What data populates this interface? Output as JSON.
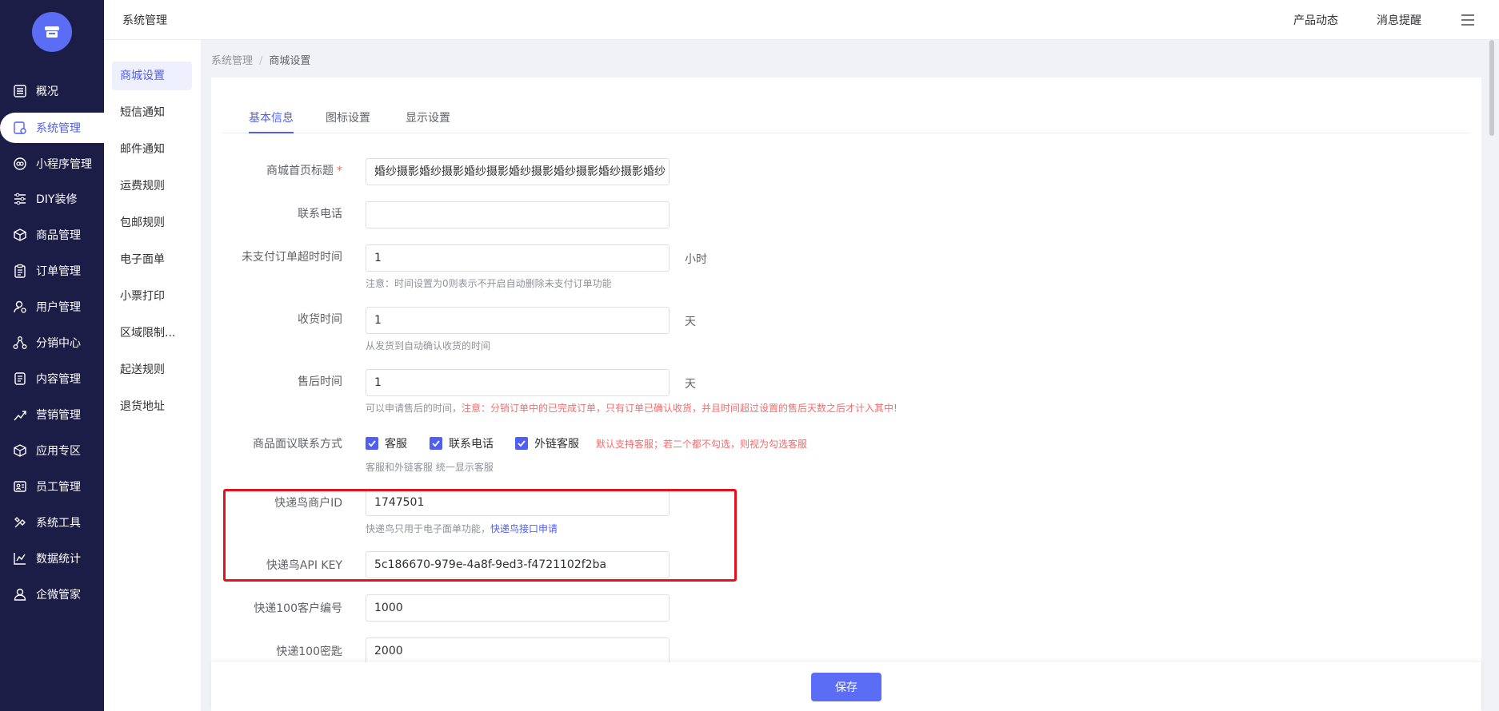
{
  "nav": {
    "items": [
      {
        "label": "概况",
        "icon": "list-icon"
      },
      {
        "label": "系统管理",
        "icon": "settings-doc-icon"
      },
      {
        "label": "小程序管理",
        "icon": "miniapp-icon"
      },
      {
        "label": "DIY装修",
        "icon": "sliders-icon"
      },
      {
        "label": "商品管理",
        "icon": "box-icon"
      },
      {
        "label": "订单管理",
        "icon": "clipboard-icon"
      },
      {
        "label": "用户管理",
        "icon": "user-gear-icon"
      },
      {
        "label": "分销中心",
        "icon": "network-icon"
      },
      {
        "label": "内容管理",
        "icon": "document-icon"
      },
      {
        "label": "营销管理",
        "icon": "chart-icon"
      },
      {
        "label": "应用专区",
        "icon": "cube-icon"
      },
      {
        "label": "员工管理",
        "icon": "id-card-icon"
      },
      {
        "label": "系统工具",
        "icon": "tools-icon"
      },
      {
        "label": "数据统计",
        "icon": "line-chart-icon"
      },
      {
        "label": "企微管家",
        "icon": "contact-icon"
      }
    ]
  },
  "submenu": {
    "items": [
      "商城设置",
      "短信通知",
      "邮件通知",
      "运费规则",
      "包邮规则",
      "电子面单",
      "小票打印",
      "区域限制...",
      "起送规则",
      "退货地址"
    ]
  },
  "header": {
    "title": "系统管理",
    "links": [
      "产品动态",
      "消息提醒"
    ]
  },
  "breadcrumb": {
    "parent": "系统管理",
    "separator": "/",
    "current": "商城设置"
  },
  "tabs": [
    "基本信息",
    "图标设置",
    "显示设置"
  ],
  "form": {
    "title_label": "商城首页标题",
    "title_value": "婚纱摄影婚纱摄影婚纱摄影婚纱摄影婚纱摄影婚纱摄影婚纱",
    "phone_label": "联系电话",
    "phone_value": "",
    "unpaid_label": "未支付订单超时时间",
    "unpaid_value": "1",
    "unpaid_unit": "小时",
    "unpaid_tip": "注意：时间设置为0则表示不开启自动删除未支付订单功能",
    "receive_label": "收货时间",
    "receive_value": "1",
    "receive_unit": "天",
    "receive_tip": "从发货到自动确认收货的时间",
    "aftersale_label": "售后时间",
    "aftersale_value": "1",
    "aftersale_unit": "天",
    "aftersale_tip": "可以申请售后的时间，",
    "aftersale_warn": "注意：分销订单中的已完成订单，只有订单已确认收货，并且时间超过设置的售后天数之后才计入其中!",
    "contact_label": "商品面议联系方式",
    "contact_options": [
      "客服",
      "联系电话",
      "外链客服"
    ],
    "contact_note": "默认支持客服；若二个都不勾选，则视为勾选客服",
    "contact_tip": "客服和外链客服 统一显示客服",
    "kdn_id_label": "快递鸟商户ID",
    "kdn_id_value": "1747501",
    "kdn_id_tip": "快递鸟只用于电子面单功能，",
    "kdn_id_link": "快递鸟接口申请",
    "kdn_key_label": "快递鸟API KEY",
    "kdn_key_value": "5c186670-979e-4a8f-9ed3-f4721102f2ba",
    "kd100_customer_label": "快递100客户编号",
    "kd100_customer_value": "1000",
    "kd100_key_label": "快递100密匙",
    "kd100_key_value": "2000"
  },
  "footer": {
    "save_label": "保存"
  },
  "colors": {
    "sidebar": "#1b1d46",
    "accent": "#4f5ff5",
    "highlight": "#e5121c",
    "warning": "#f56c6c"
  }
}
